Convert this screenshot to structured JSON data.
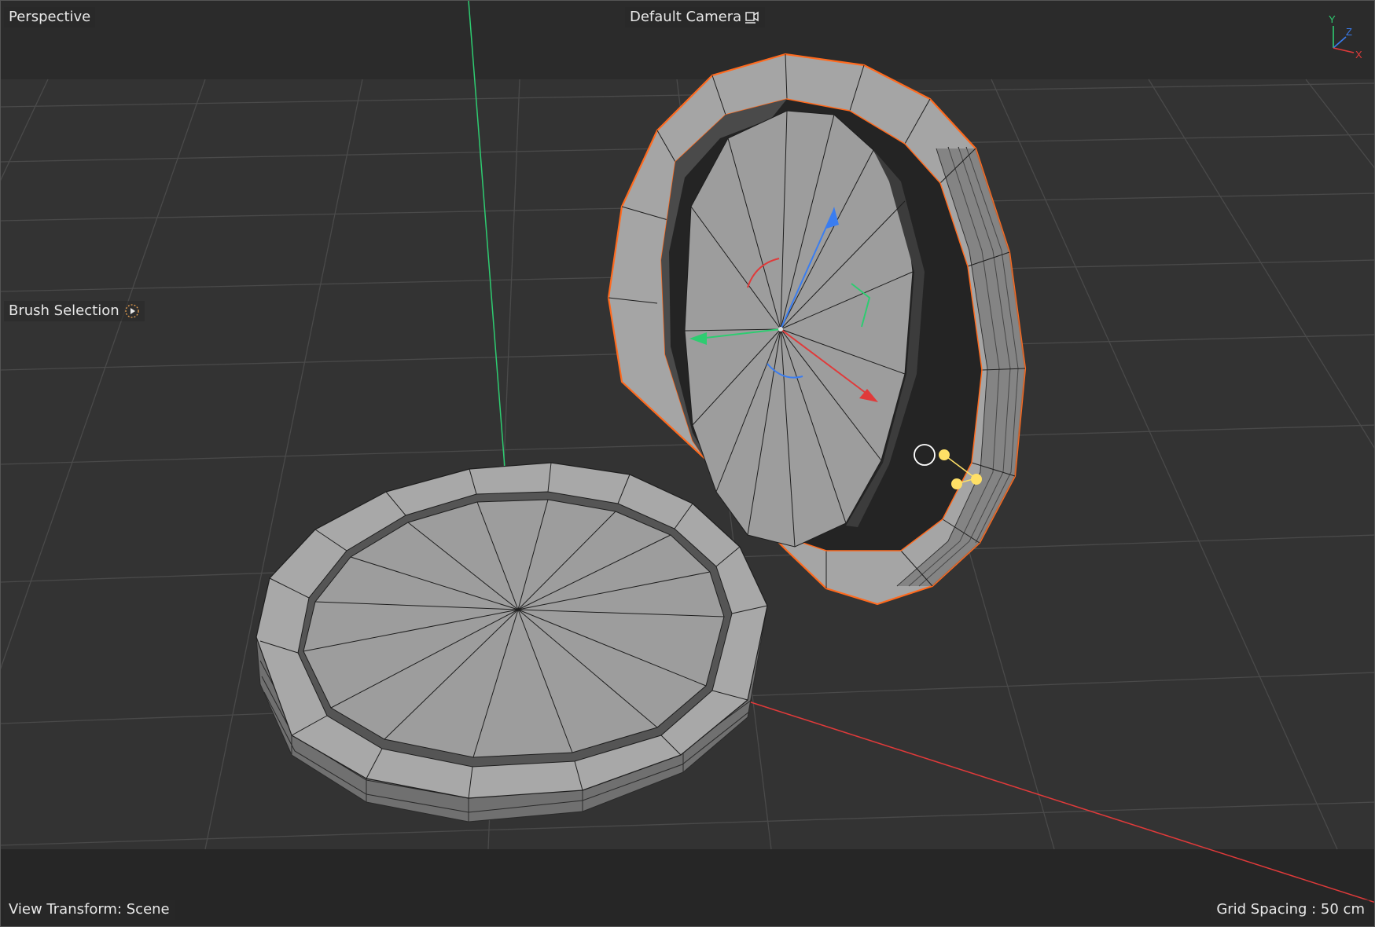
{
  "viewport": {
    "view_name": "Perspective",
    "camera_name": "Default Camera",
    "tool_name": "Brush Selection",
    "view_transform": "View Transform: Scene",
    "grid_spacing": "Grid Spacing : 50 cm"
  },
  "axis_gizmo": {
    "y_label": "Y",
    "z_label": "Z",
    "x_label": "X"
  },
  "icons": {
    "camera": "camera-icon",
    "tool": "brush-tool-icon"
  },
  "colors": {
    "background": "#333333",
    "top_band": "#2b2b2b",
    "bottom_band": "#262626",
    "grid": "#4a4a4a",
    "selection": "#ff6a1e",
    "axis_x": "#e03a3a",
    "axis_y": "#2ecc71",
    "axis_z": "#3a7df0",
    "mesh_light": "#a8a8a8",
    "mesh_dark": "#6c6c6c"
  }
}
